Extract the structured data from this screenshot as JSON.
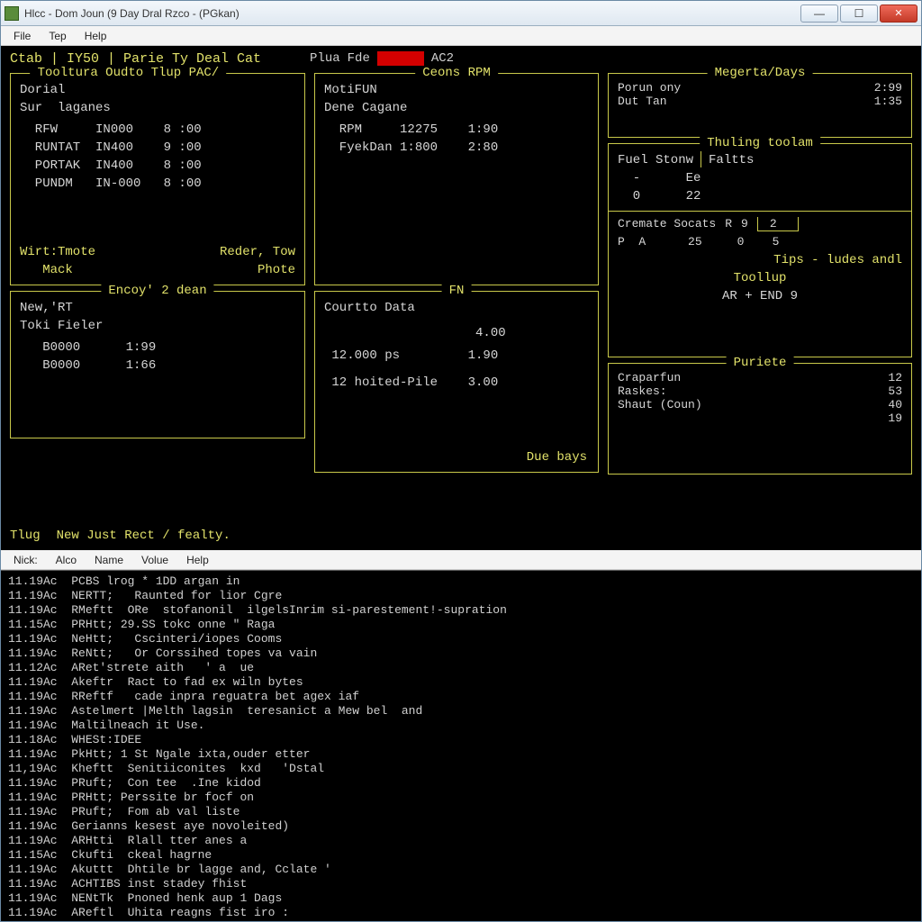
{
  "window": {
    "title": "Hlcc - Dom Joun (9 Day Dral Rzco - (PGkan)"
  },
  "menubar": {
    "items": [
      "File",
      "Tep",
      "Help"
    ]
  },
  "tabstrip": "Ctab | IY50 | Parie  Ty Deal Cat",
  "status": {
    "a": "Plua",
    "b": "Fde",
    "c": "AC2"
  },
  "panel_tooltura": {
    "legend": "Tooltura Oudto Tlup PAC/",
    "l1": "Dorial",
    "l2": "Sur  laganes",
    "rows": [
      "  RFW     IN000    8 :00",
      "  RUNTAT  IN400    9 :00",
      "  PORTAK  IN400    8 :00",
      "  PUNDM   IN-000   8 :00"
    ],
    "foot_left_a": "Wirt:Tmote",
    "foot_left_b": "Mack",
    "foot_right_a": "Reder, Tow",
    "foot_right_b": "Phote"
  },
  "panel_encoy": {
    "legend": "Encoy' 2 dean",
    "l1": "New,'RT",
    "l2": "Toki Fieler",
    "rows": [
      "   B0000      1:99",
      "   B0000      1:66"
    ]
  },
  "bottom_left": {
    "a": "Tlug",
    "b": "New Just Rect / fealty."
  },
  "panel_ceons": {
    "legend": "Ceons RPM",
    "l1": "MotiFUN",
    "l2": "Dene Cagane",
    "rows": [
      "  RPM     12275    1:90",
      "  FyekDan 1:800    2:80"
    ]
  },
  "panel_fn": {
    "legend": "FN",
    "l1": "Courtto Data",
    "rows": [
      "                    4.00",
      " 12.000 ps         1.90",
      " 12 hoited-Pile    3.00"
    ],
    "foot": "Due bays"
  },
  "panel_megerta": {
    "legend": "Megerta/Days",
    "rows": [
      [
        "Porun ony",
        "2:99"
      ],
      [
        "Dut Tan",
        "1:35"
      ]
    ]
  },
  "panel_thuling": {
    "legend": "Thuling toolam",
    "h1": "Fuel Stonw",
    "h2": "Faltts",
    "rows": [
      "  -      Ee",
      "  0      22"
    ],
    "cremate_a": "Cremate Socats",
    "cremate_b": "R",
    "cremate_c": "9",
    "cremate_d": "2",
    "pa": "P  A      25     0    5",
    "tips": "Tips - ludes andl",
    "toollup": "Toollup",
    "arend": "AR + END 9"
  },
  "panel_purete": {
    "legend": "Puriete",
    "rows": [
      [
        "Craparfun",
        "12"
      ],
      [
        "Raskes:",
        "53"
      ],
      [
        "Shaut (Coun)",
        "40"
      ],
      [
        "",
        "19"
      ]
    ]
  },
  "menubar2": {
    "items": [
      "Nick:",
      "Alco",
      "Name",
      "Volue",
      "Help"
    ]
  },
  "log": [
    "11.19Ac  PCBS lrog * 1DD argan in",
    "11.19Ac  NERTT;   Raunted for lior Cgre",
    "11.19Ac  RMeftt  ORe  stofanonil  ilgelsInrim si-parestement!-supration",
    "11.15Ac  PRHtt; 29.SS tokc onne \" Raga",
    "11.19Ac  NeHtt;   Cscinteri/iopes Cooms",
    "11.19Ac  ReNtt;   Or Corssihed topes va vain",
    "11.12Ac  ARet'strete aith   ' a  ue",
    "11.19Ac  Akeftr  Ract to fad ex wiln bytes",
    "11.19Ac  RReftf   cade inpra reguatra bet agex iaf",
    "11.19Ac  Astelmert |Melth lagsin  teresanict a Mew bel  and",
    "11.19Ac  Maltilneach it Use.",
    "11.18Ac  WHESt:IDEE",
    "11.19Ac  PkHtt; 1 St Ngale ixta,ouder etter",
    "11,19Ac  Kheftt  Senitiiconites  kxd   'Dstal",
    "11.19Ac  PRuft;  Con tee  .Ine kidod",
    "11.19Ac  PRHtt; Perssite br focf on",
    "11.19Ac  PRuft;  Fom ab val liste",
    "11.19Ac  Gerianns kesest aye novoleited)",
    "11.19Ac  ARHtti  Rlall tter anes a",
    "11.15Ac  Ckufti  ckeal hagrne",
    "11.19Ac  Akuttt  Dhtile br lagge and, Cclate '",
    "11.19Ac  ACHTIBS inst stadey fhist",
    "11.19Ac  NENtTk  Pnoned henk aup 1 Dags",
    "11.19Ac  AReftl  Uhita reagns fist iro :"
  ]
}
